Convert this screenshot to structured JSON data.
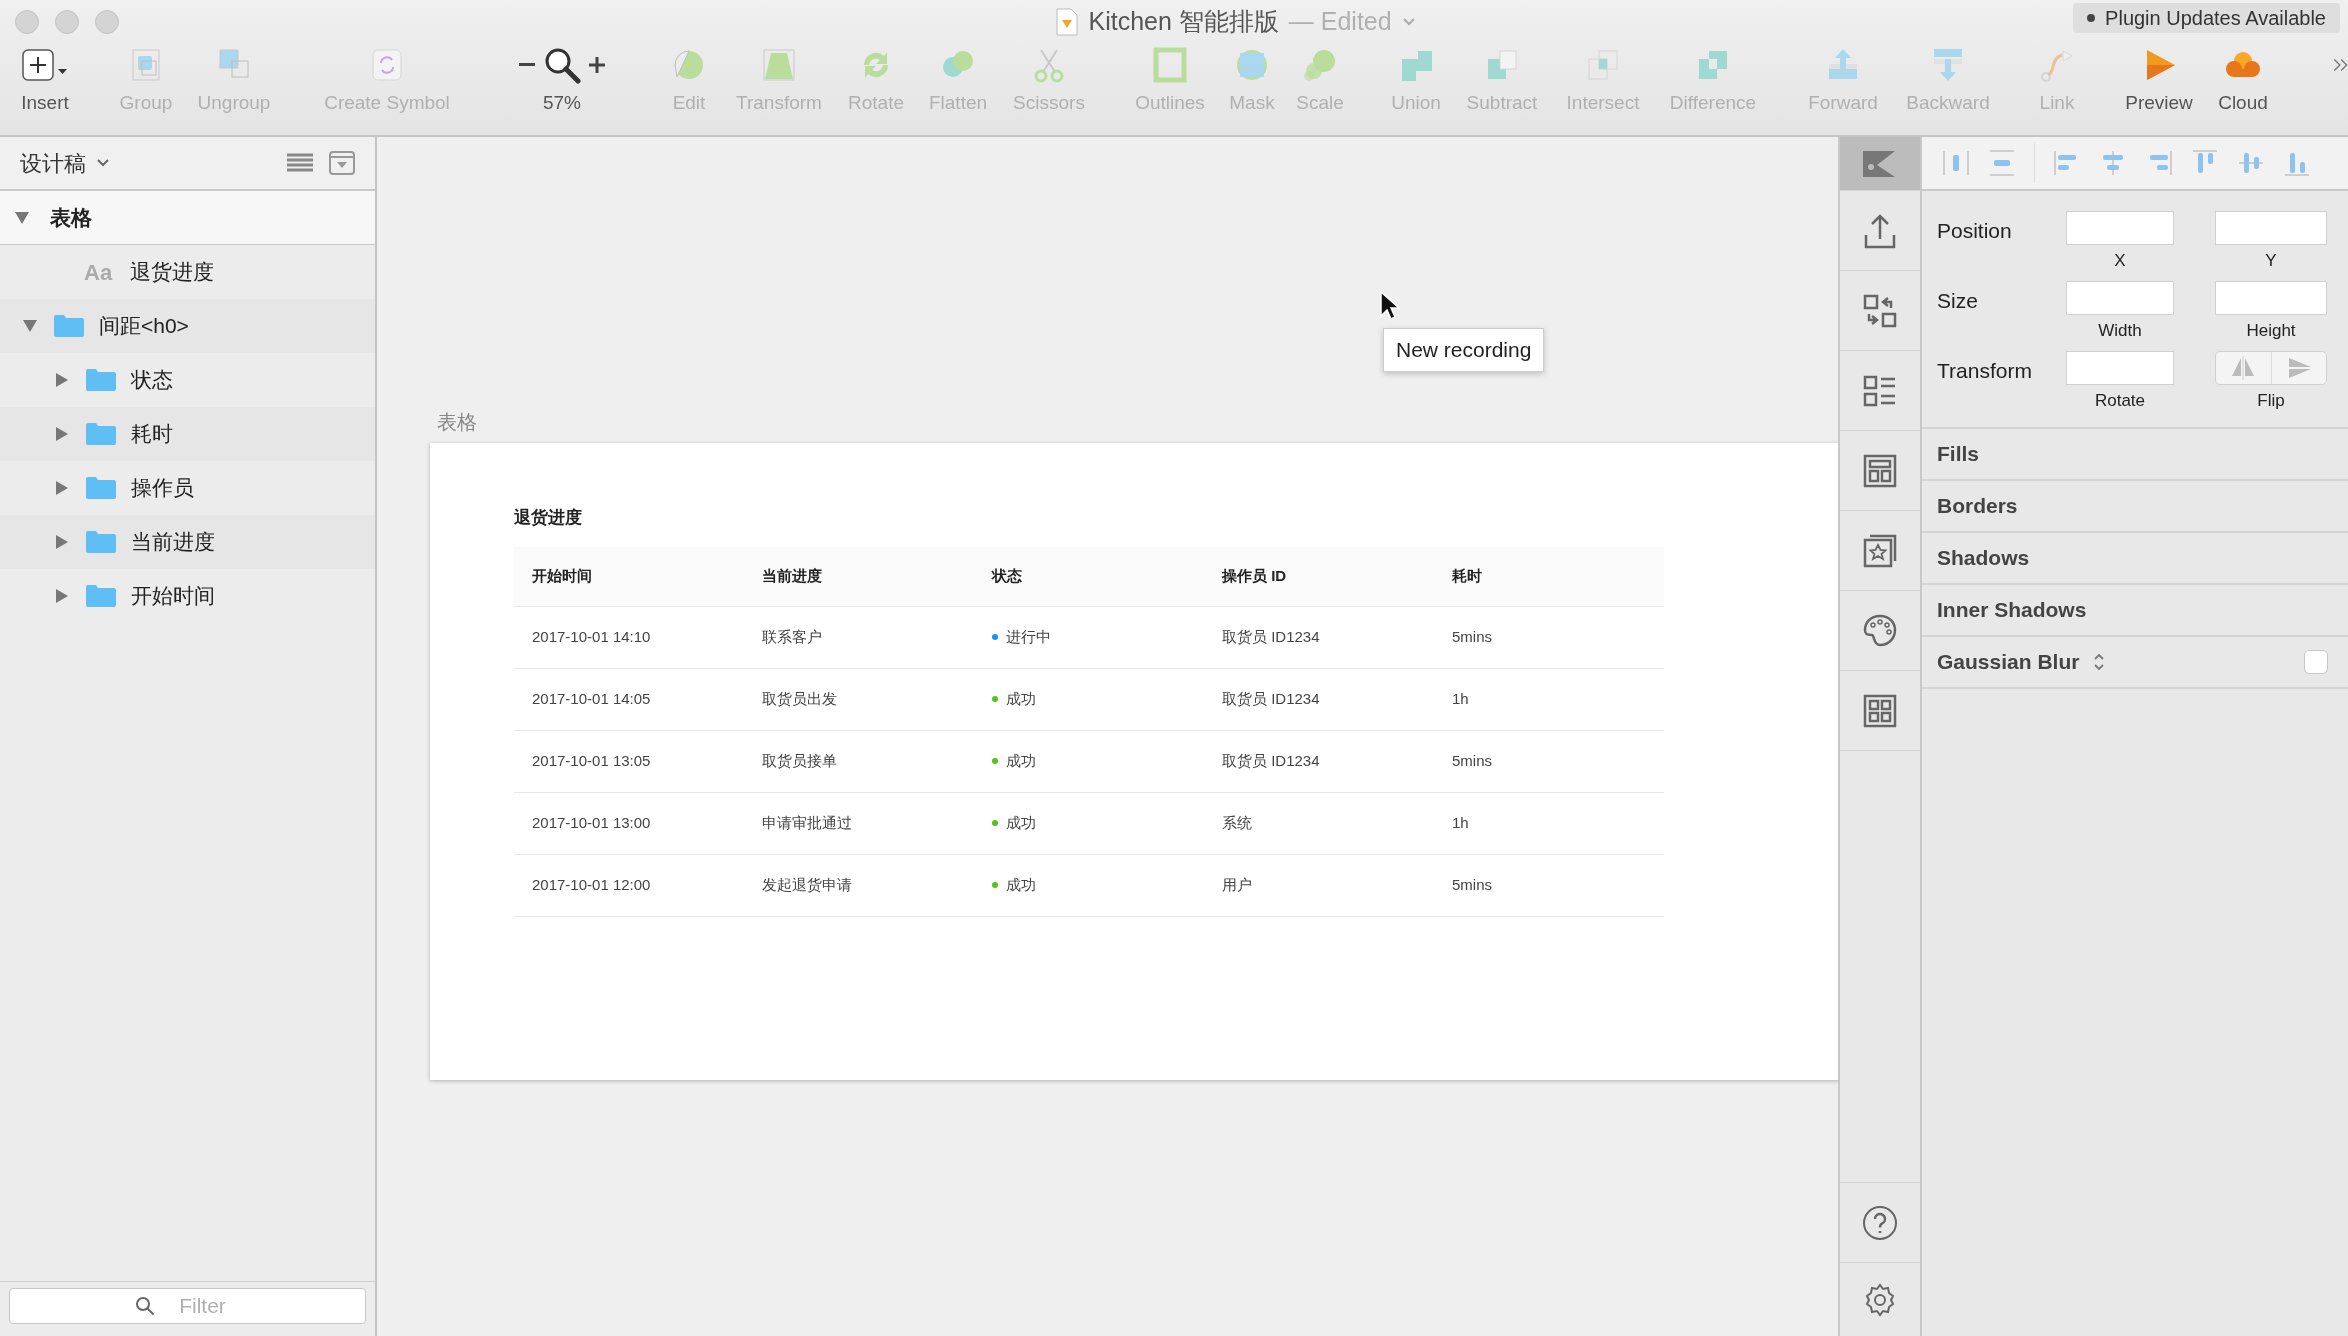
{
  "window": {
    "title": "Kitchen 智能排版",
    "status": "— Edited"
  },
  "plugin_badge": "Plugin Updates Available",
  "toolbar": [
    {
      "kind": "button",
      "label": "Insert",
      "disabled": false
    },
    {
      "kind": "button",
      "label": "Group",
      "disabled": true
    },
    {
      "kind": "button",
      "label": "Ungroup",
      "disabled": true
    },
    {
      "kind": "button",
      "label": "Create Symbol",
      "disabled": true
    },
    {
      "kind": "zoom",
      "label": "57%",
      "disabled": false
    },
    {
      "kind": "button",
      "label": "Edit",
      "disabled": true
    },
    {
      "kind": "button",
      "label": "Transform",
      "disabled": true
    },
    {
      "kind": "button",
      "label": "Rotate",
      "disabled": true
    },
    {
      "kind": "button",
      "label": "Flatten",
      "disabled": true
    },
    {
      "kind": "button",
      "label": "Scissors",
      "disabled": true
    },
    {
      "kind": "button",
      "label": "Outlines",
      "disabled": true
    },
    {
      "kind": "button",
      "label": "Mask",
      "disabled": true
    },
    {
      "kind": "button",
      "label": "Scale",
      "disabled": true
    },
    {
      "kind": "button",
      "label": "Union",
      "disabled": true
    },
    {
      "kind": "button",
      "label": "Subtract",
      "disabled": true
    },
    {
      "kind": "button",
      "label": "Intersect",
      "disabled": true
    },
    {
      "kind": "button",
      "label": "Difference",
      "disabled": true
    },
    {
      "kind": "button",
      "label": "Forward",
      "disabled": true
    },
    {
      "kind": "button",
      "label": "Backward",
      "disabled": true
    },
    {
      "kind": "button",
      "label": "Link",
      "disabled": true
    },
    {
      "kind": "button",
      "label": "Preview",
      "disabled": false
    },
    {
      "kind": "button",
      "label": "Cloud",
      "disabled": false
    }
  ],
  "sidebar": {
    "page": "设计稿",
    "filter": {
      "placeholder": "Filter"
    },
    "layers": [
      {
        "kind": "artboard",
        "label": "表格",
        "expanded": true,
        "children": [
          {
            "kind": "text",
            "label": "退货进度",
            "glyph": "Aa"
          },
          {
            "kind": "group",
            "label": "间距<h0>",
            "expanded": true,
            "children": [
              {
                "kind": "group",
                "label": "状态",
                "expanded": false
              },
              {
                "kind": "group",
                "label": "耗时",
                "expanded": false
              },
              {
                "kind": "group",
                "label": "操作员",
                "expanded": false
              },
              {
                "kind": "group",
                "label": "当前进度",
                "expanded": false
              },
              {
                "kind": "group",
                "label": "开始时间",
                "expanded": false
              }
            ]
          }
        ]
      }
    ]
  },
  "canvas": {
    "artboard_label": "表格",
    "tooltip": "New recording",
    "table": {
      "title": "退货进度",
      "columns": [
        "开始时间",
        "当前进度",
        "状态",
        "操作员 ID",
        "耗时"
      ],
      "rows": [
        {
          "start": "2017-10-01  14:10",
          "progress": "联系客户",
          "status": {
            "label": "进行中",
            "color": "#1890ff"
          },
          "operator": "取货员 ID1234",
          "duration": "5mins"
        },
        {
          "start": "2017-10-01  14:05",
          "progress": "取货员出发",
          "status": {
            "label": "成功",
            "color": "#52c41a"
          },
          "operator": "取货员 ID1234",
          "duration": "1h"
        },
        {
          "start": "2017-10-01  13:05",
          "progress": "取货员接单",
          "status": {
            "label": "成功",
            "color": "#52c41a"
          },
          "operator": "取货员 ID1234",
          "duration": "5mins"
        },
        {
          "start": "2017-10-01  13:00",
          "progress": "申请审批通过",
          "status": {
            "label": "成功",
            "color": "#52c41a"
          },
          "operator": "系统",
          "duration": "1h"
        },
        {
          "start": "2017-10-01  12:00",
          "progress": "发起退货申请",
          "status": {
            "label": "成功",
            "color": "#52c41a"
          },
          "operator": "用户",
          "duration": "5mins"
        }
      ]
    }
  },
  "inspector": {
    "tabs": [
      {
        "selected": true
      },
      {
        "selected": false
      },
      {
        "selected": false
      },
      {
        "selected": false
      },
      {
        "selected": false
      },
      {
        "selected": false
      },
      {
        "selected": false
      },
      {
        "selected": false
      }
    ],
    "fields": [
      {
        "label": "Position",
        "a": "X",
        "b": "Y",
        "kind": "pair"
      },
      {
        "label": "Size",
        "a": "Width",
        "b": "Height",
        "kind": "pair"
      },
      {
        "label": "Transform",
        "a": "Rotate",
        "b": "Flip",
        "kind": "flip"
      }
    ],
    "sections": [
      {
        "kind": "plain",
        "label": "Fills"
      },
      {
        "kind": "plain",
        "label": "Borders"
      },
      {
        "kind": "plain",
        "label": "Shadows"
      },
      {
        "kind": "plain",
        "label": "Inner Shadows"
      },
      {
        "kind": "blur",
        "label": "Gaussian Blur",
        "checked": false
      }
    ]
  }
}
